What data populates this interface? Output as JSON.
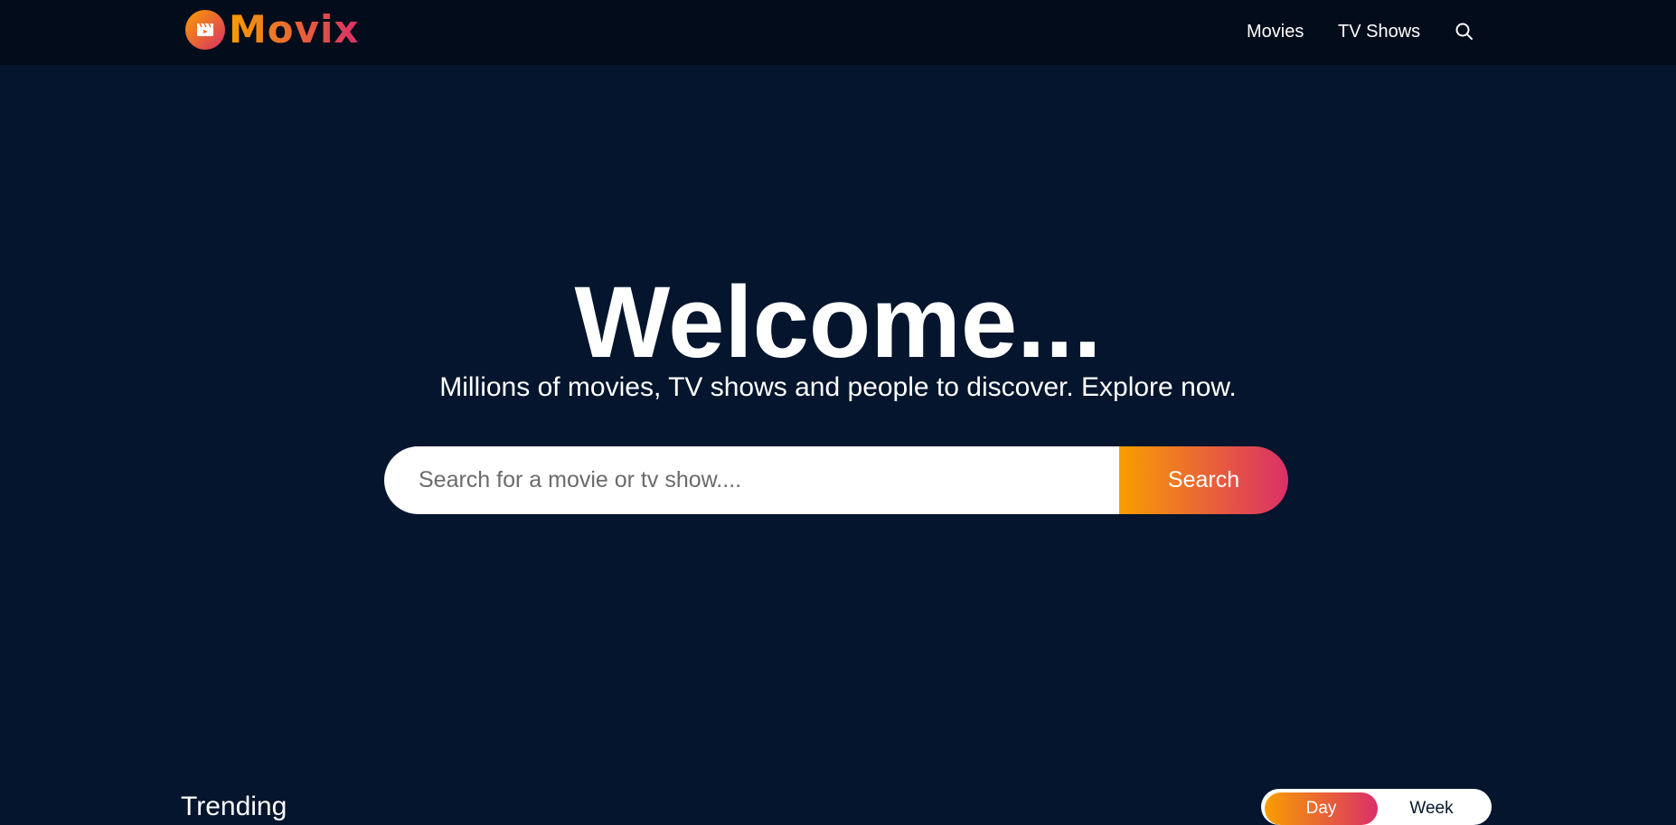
{
  "colors": {
    "background": "#04152d",
    "header_background": "#020c1b",
    "gradient_start": "#f89e00",
    "gradient_end": "#da2f68",
    "text": "#ffffff"
  },
  "header": {
    "logo_text": "Movix",
    "logo_icon": "clapperboard-icon",
    "nav": {
      "movies": "Movies",
      "tv_shows": "TV Shows",
      "search_icon": "search-icon"
    }
  },
  "hero": {
    "title": "Welcome...",
    "subtitle": "Millions of movies, TV shows and people to discover. Explore now.",
    "search": {
      "placeholder": "Search for a movie or tv show....",
      "value": "",
      "button_label": "Search"
    }
  },
  "trending": {
    "title": "Trending",
    "tabs": [
      "Day",
      "Week"
    ],
    "selected_tab": "Day"
  }
}
